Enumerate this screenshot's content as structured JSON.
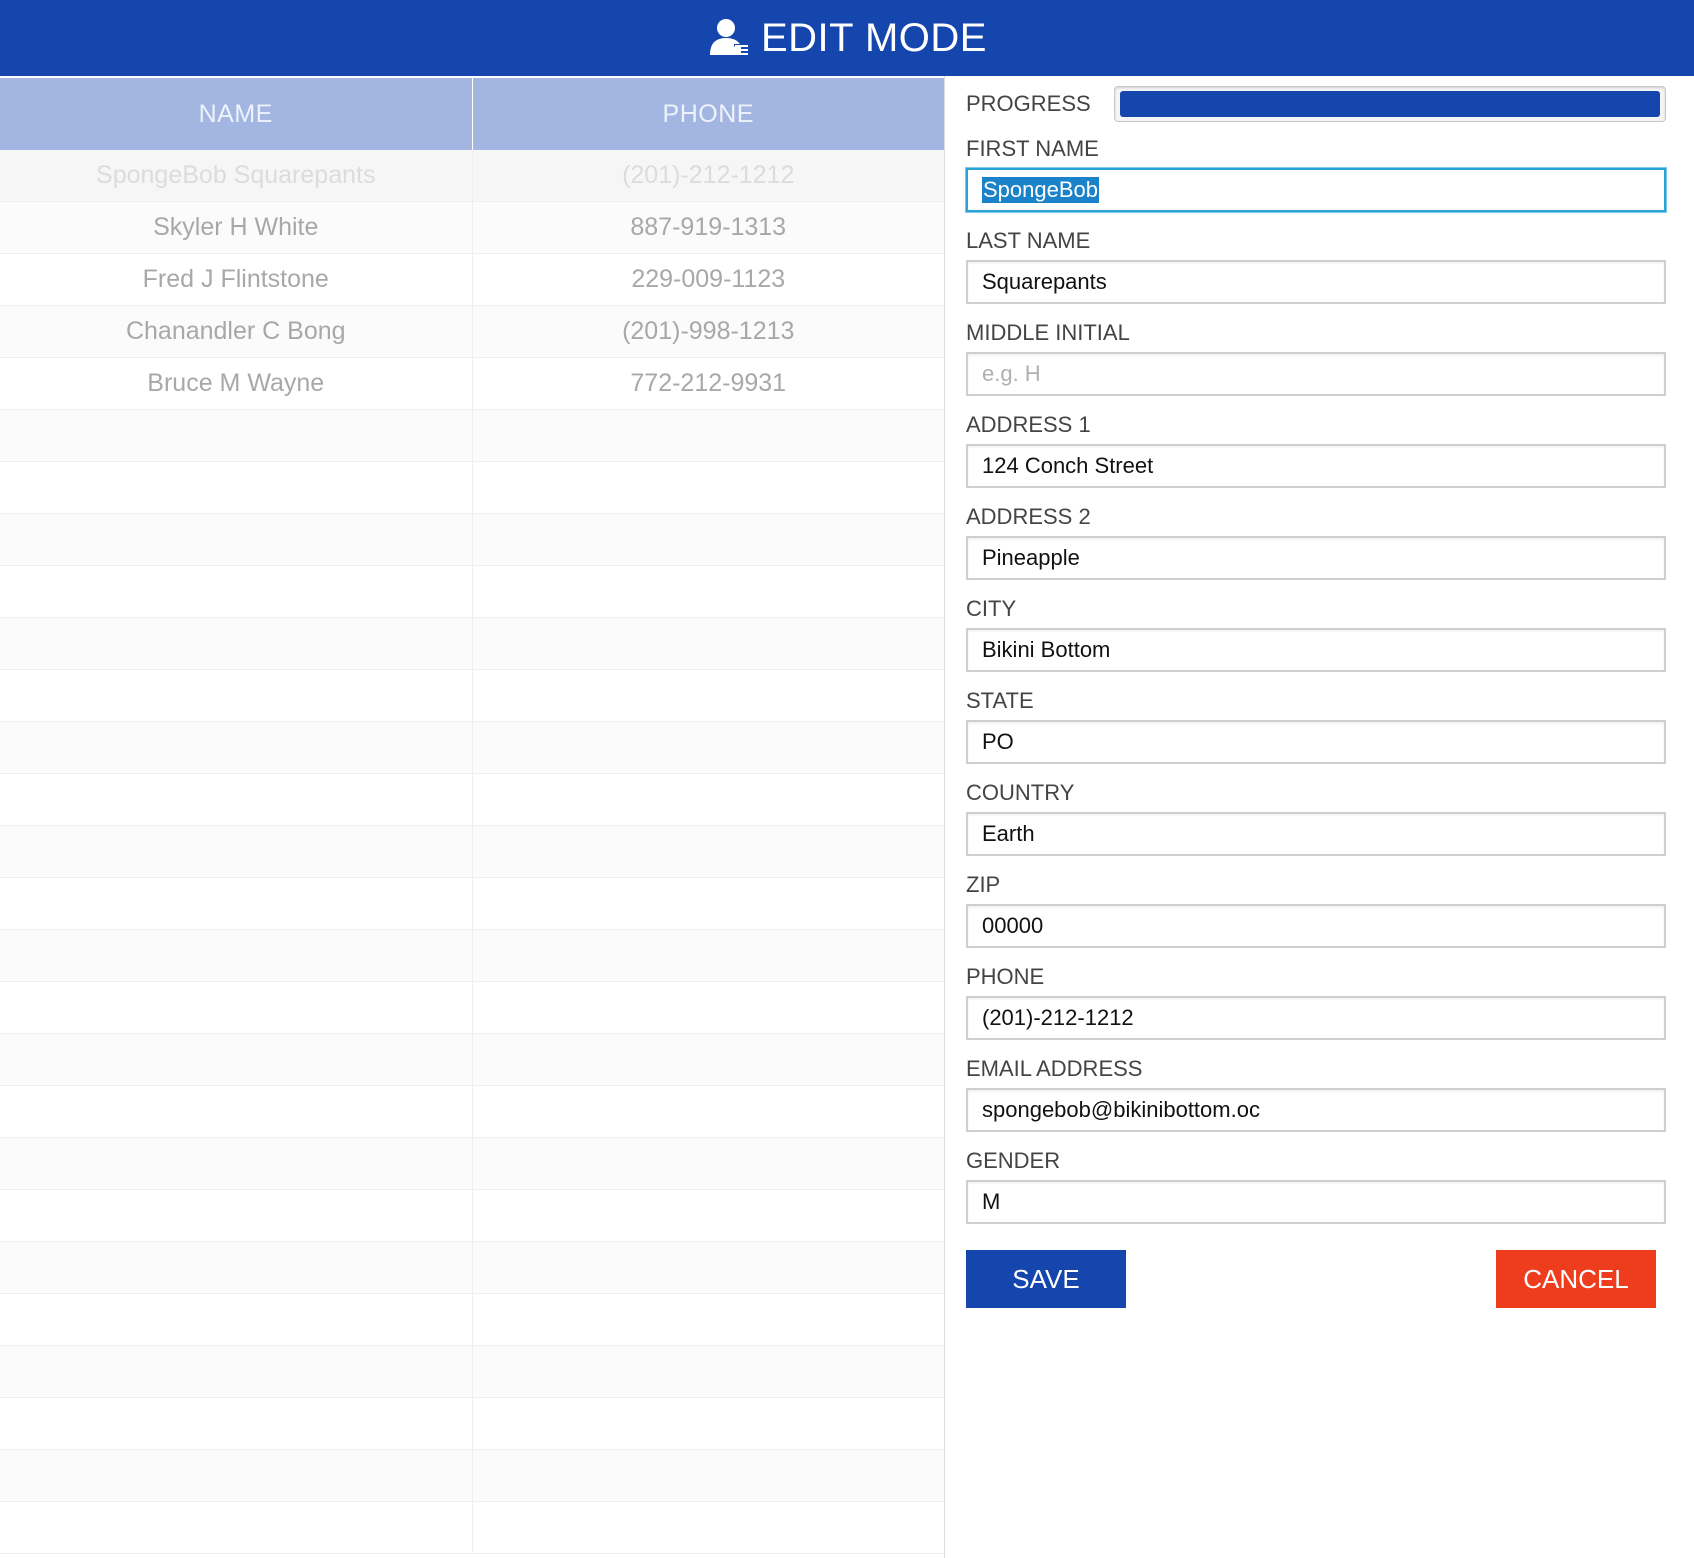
{
  "header": {
    "title": "EDIT MODE",
    "icon": "user-edit-icon"
  },
  "table": {
    "columns": [
      "NAME",
      "PHONE"
    ],
    "rows": [
      {
        "name": "SpongeBob  Squarepants",
        "phone": "(201)-212-1212",
        "selected": true
      },
      {
        "name": "Skyler H White",
        "phone": "887-919-1313"
      },
      {
        "name": "Fred J Flintstone",
        "phone": "229-009-1123"
      },
      {
        "name": "Chanandler C Bong",
        "phone": "(201)-998-1213"
      },
      {
        "name": "Bruce M Wayne",
        "phone": "772-212-9931"
      }
    ]
  },
  "form": {
    "progress": {
      "label": "PROGRESS",
      "value": 1.0
    },
    "fields": [
      {
        "label": "FIRST NAME",
        "value": "SpongeBob",
        "placeholder": "",
        "focused": true
      },
      {
        "label": "LAST NAME",
        "value": "Squarepants",
        "placeholder": ""
      },
      {
        "label": "MIDDLE INITIAL",
        "value": "",
        "placeholder": "e.g. H"
      },
      {
        "label": "ADDRESS 1",
        "value": "124 Conch Street",
        "placeholder": ""
      },
      {
        "label": "ADDRESS 2",
        "value": "Pineapple",
        "placeholder": ""
      },
      {
        "label": "CITY",
        "value": "Bikini Bottom",
        "placeholder": ""
      },
      {
        "label": "STATE",
        "value": "PO",
        "placeholder": ""
      },
      {
        "label": "COUNTRY",
        "value": "Earth",
        "placeholder": ""
      },
      {
        "label": "ZIP",
        "value": "00000",
        "placeholder": ""
      },
      {
        "label": "PHONE",
        "value": "(201)-212-1212",
        "placeholder": ""
      },
      {
        "label": "EMAIL ADDRESS",
        "value": "spongebob@bikinibottom.oc",
        "placeholder": ""
      },
      {
        "label": "GENDER",
        "value": "M",
        "placeholder": ""
      }
    ],
    "save_label": "SAVE",
    "cancel_label": "CANCEL"
  },
  "colors": {
    "primary": "#1546ae",
    "table_header": "#a3b6e2",
    "cancel": "#ee3d1c",
    "focus": "#2aa2d8"
  }
}
